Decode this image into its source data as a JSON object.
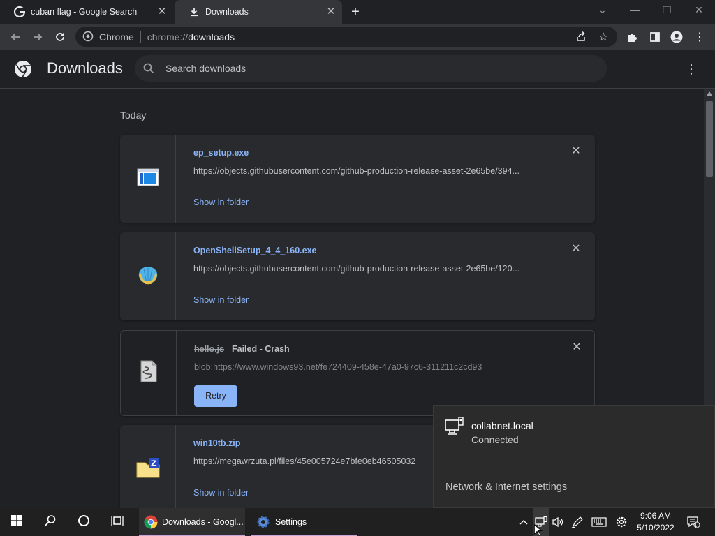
{
  "browser": {
    "tabs": [
      {
        "title": "cuban flag - Google Search",
        "icon": "google-icon",
        "active": false
      },
      {
        "title": "Downloads",
        "icon": "download-icon",
        "active": true
      }
    ],
    "omnibox": {
      "site_label": "Chrome",
      "url_scheme": "chrome://",
      "url_host": "downloads"
    }
  },
  "downloads_page": {
    "title": "Downloads",
    "search_placeholder": "Search downloads",
    "section_label": "Today",
    "items": [
      {
        "filename": "ep_setup.exe",
        "url": "https://objects.githubusercontent.com/github-production-release-asset-2e65be/394...",
        "action": "Show in folder",
        "icon": "exe-window-icon"
      },
      {
        "filename": "OpenShellSetup_4_4_160.exe",
        "url": "https://objects.githubusercontent.com/github-production-release-asset-2e65be/120...",
        "action": "Show in folder",
        "icon": "shell-icon"
      },
      {
        "filename": "hello.js",
        "status": "Failed - Crash",
        "url": "blob:https://www.windows93.net/fe724409-458e-47a0-97c6-311211c2cd93",
        "action": "Retry",
        "icon": "script-file-icon"
      },
      {
        "filename": "win10tb.zip",
        "url": "https://megawrzuta.pl/files/45e005724e7bfe0eb46505032",
        "action": "Show in folder",
        "icon": "zip-folder-icon"
      }
    ]
  },
  "network_flyout": {
    "network_name": "collabnet.local",
    "network_status": "Connected",
    "settings_link": "Network & Internet settings"
  },
  "taskbar": {
    "apps": [
      {
        "label": "Downloads - Googl...",
        "icon": "chrome-icon"
      },
      {
        "label": "Settings",
        "icon": "settings-gear-icon"
      }
    ],
    "time": "9:06 AM",
    "date": "5/10/2022",
    "notification_count": "1"
  },
  "colors": {
    "accent": "#8ab4f8",
    "background": "#202124",
    "card": "#292a2d",
    "taskbar": "#202020"
  }
}
